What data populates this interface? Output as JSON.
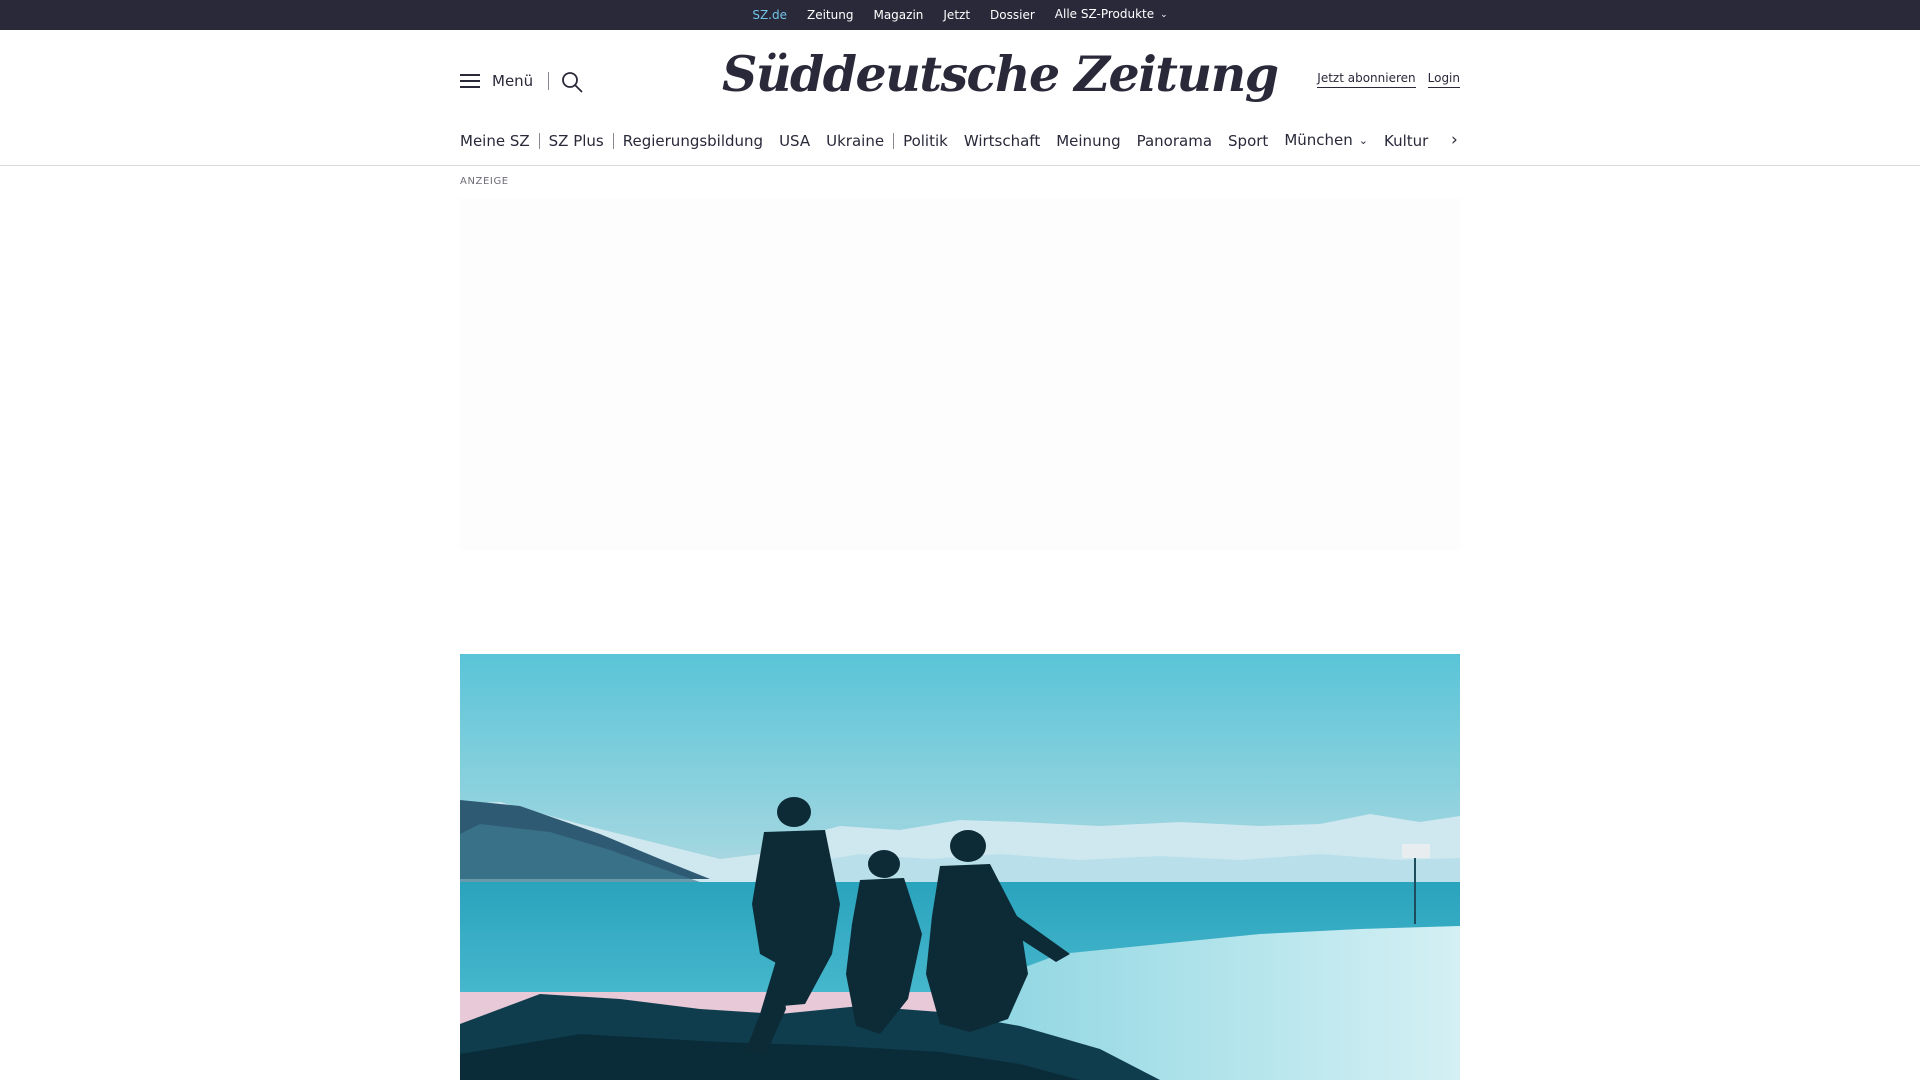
{
  "topbar": {
    "links": [
      {
        "label": "SZ.de"
      },
      {
        "label": "Zeitung"
      },
      {
        "label": "Magazin"
      },
      {
        "label": "Jetzt"
      },
      {
        "label": "Dossier"
      },
      {
        "label": "Alle SZ-Produkte"
      }
    ],
    "active_color": "#71c5e8",
    "background": "#29293a"
  },
  "header": {
    "menu_label": "Menü",
    "logo_text": "Süddeutsche Zeitung",
    "subscribe_label": "Jetzt abonnieren",
    "login_label": "Login"
  },
  "nav": {
    "items": [
      {
        "label": "Meine SZ"
      },
      {
        "label": "SZ Plus"
      },
      {
        "label": "Regierungsbildung"
      },
      {
        "label": "USA"
      },
      {
        "label": "Ukraine"
      },
      {
        "label": "Politik"
      },
      {
        "label": "Wirtschaft"
      },
      {
        "label": "Meinung"
      },
      {
        "label": "Panorama"
      },
      {
        "label": "Sport"
      },
      {
        "label": "München"
      },
      {
        "label": "Kultur"
      }
    ]
  },
  "ad": {
    "label": "ANZEIGE"
  },
  "icons": {
    "menu": "hamburger-icon",
    "search": "search-icon",
    "dropdown": "chevron-down-icon",
    "next": "chevron-right-icon"
  }
}
